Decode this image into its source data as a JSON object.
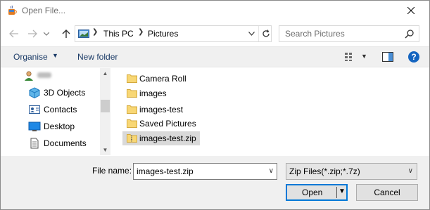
{
  "window": {
    "title": "Open File...",
    "app_icon": "java-cup-icon"
  },
  "nav": {
    "back_icon": "arrow-left-icon",
    "forward_icon": "arrow-right-icon",
    "recent_icon": "chevron-down-icon",
    "up_icon": "arrow-up-icon",
    "breadcrumb": [
      "This PC",
      "Pictures"
    ],
    "search_placeholder": "Search Pictures"
  },
  "toolbar": {
    "organise_label": "Organise",
    "new_folder_label": "New folder",
    "help_label": "?"
  },
  "nav_pane": {
    "items": [
      {
        "label": "",
        "icon": "user-icon",
        "blurred": true
      },
      {
        "label": "3D Objects",
        "icon": "3d-objects-icon"
      },
      {
        "label": "Contacts",
        "icon": "contacts-icon"
      },
      {
        "label": "Desktop",
        "icon": "desktop-icon"
      },
      {
        "label": "Documents",
        "icon": "documents-icon"
      }
    ]
  },
  "files": [
    {
      "name": "Camera Roll",
      "type": "folder",
      "selected": false
    },
    {
      "name": "images",
      "type": "folder",
      "selected": false
    },
    {
      "name": "images-test",
      "type": "folder",
      "selected": false
    },
    {
      "name": "Saved Pictures",
      "type": "folder",
      "selected": false
    },
    {
      "name": "images-test.zip",
      "type": "zip",
      "selected": true
    }
  ],
  "bottom": {
    "file_name_label": "File name:",
    "file_name_value": "images-test.zip",
    "file_type_value": "Zip Files(*.zip;*.7z)",
    "open_label": "Open",
    "cancel_label": "Cancel"
  },
  "colors": {
    "accent": "#0078d7",
    "folder": "#f8d775",
    "link": "#1a3a66",
    "selection": "#d9d9d9"
  }
}
